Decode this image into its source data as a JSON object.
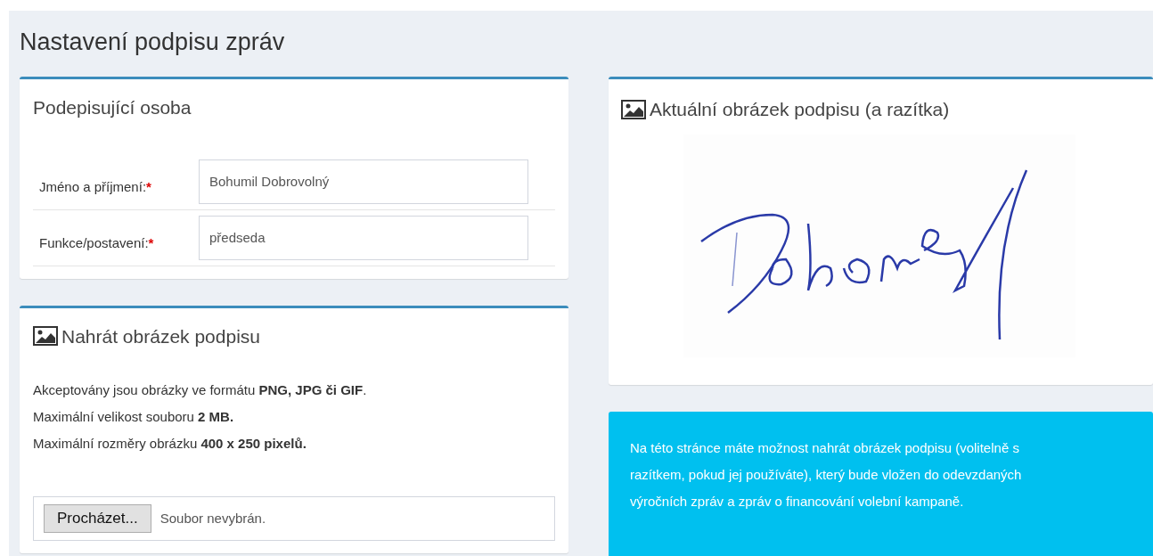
{
  "page_title": "Nastavení podpisu zpráv",
  "signer_box": {
    "title": "Podepisující osoba",
    "fields": [
      {
        "label": "Jméno a příjmení:",
        "required_mark": "*",
        "value": "Bohumil Dobrovolný"
      },
      {
        "label": "Funkce/postavení:",
        "required_mark": "*",
        "value": "předseda"
      }
    ]
  },
  "upload_box": {
    "title": "Nahrát obrázek podpisu",
    "lines": [
      "Akceptovány jsou obrázky ve formátu **PNG, JPG či GIF**.",
      "Maximální velikost souboru **2 MB.**",
      "Maximální rozměry obrázku **400 x 250 pixelů.**"
    ],
    "browse_button": "Procházet...",
    "file_status": "Soubor nevybrán."
  },
  "current_box": {
    "title": "Aktuální obrázek podpisu (a razítka)"
  },
  "info_box": {
    "text": "Na této stránce máte možnost nahrát obrázek podpisu (volitelně s razítkem, pokud jej používáte), který bude vložen do odevzdaných výročních zpráv a zpráv o financování volební kampaně."
  }
}
